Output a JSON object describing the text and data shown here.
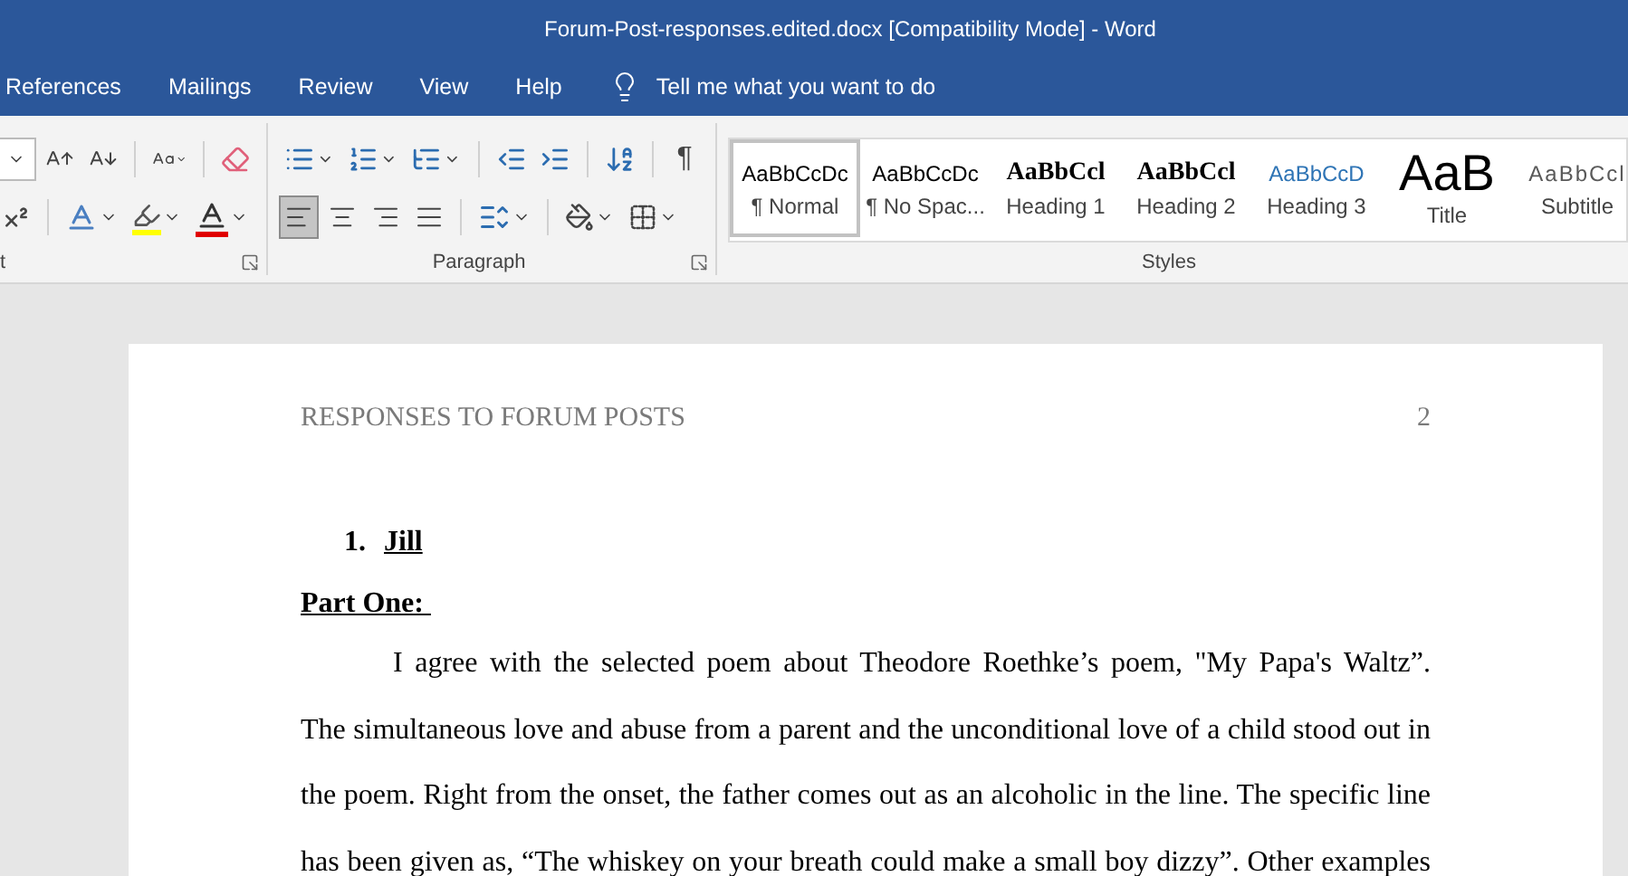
{
  "window": {
    "title": "Forum-Post-responses.edited.docx [Compatibility Mode]  -  Word"
  },
  "tabs": [
    {
      "label": "References",
      "selected": false
    },
    {
      "label": "Mailings",
      "selected": false
    },
    {
      "label": "Review",
      "selected": false
    },
    {
      "label": "View",
      "selected": false
    },
    {
      "label": "Help",
      "selected": false
    }
  ],
  "tell_me": {
    "placeholder": "Tell me what you want to do"
  },
  "font_group": {
    "label": "t"
  },
  "paragraph_group": {
    "label": "Paragraph",
    "alignment": [
      {
        "kind": "left",
        "selected": true
      },
      {
        "kind": "center",
        "selected": false
      },
      {
        "kind": "right",
        "selected": false
      },
      {
        "kind": "justify",
        "selected": false
      }
    ],
    "show_marks": {
      "label": "¶",
      "selected": false
    }
  },
  "styles_group": {
    "label": "Styles",
    "items": [
      {
        "kind": "normal",
        "preview": "AaBbCcDc",
        "name": "¶ Normal",
        "selected": true
      },
      {
        "kind": "nospacing",
        "preview": "AaBbCcDc",
        "name": "¶ No Spac...",
        "selected": false
      },
      {
        "kind": "heading1",
        "preview": "AaBbCcl",
        "name": "Heading 1",
        "selected": false
      },
      {
        "kind": "heading2",
        "preview": "AaBbCcl",
        "name": "Heading 2",
        "selected": false
      },
      {
        "kind": "heading3",
        "preview": "AaBbCcD",
        "name": "Heading 3",
        "selected": false
      },
      {
        "kind": "title",
        "preview": "AaB",
        "name": "Title",
        "selected": false
      },
      {
        "kind": "subtitle",
        "preview": "AaBbCcl",
        "name": "Subtitle",
        "selected": false
      }
    ]
  },
  "document": {
    "header": "RESPONSES TO FORUM POSTS",
    "page_number": "2",
    "list_item": {
      "number": "1.",
      "text": "Jill"
    },
    "heading": "Part One: ",
    "paragraph_lines": [
      "I agree with the selected poem about Theodore Roethke’s poem, \"My Papa's Waltz”.",
      "The simultaneous love and abuse from a parent and the unconditional love of a child stood out in",
      "the poem. Right from the onset, the father comes out as an alcoholic in the line. The specific line",
      "has been given as, “The whiskey on your breath could make a small boy dizzy”. Other examples"
    ]
  }
}
